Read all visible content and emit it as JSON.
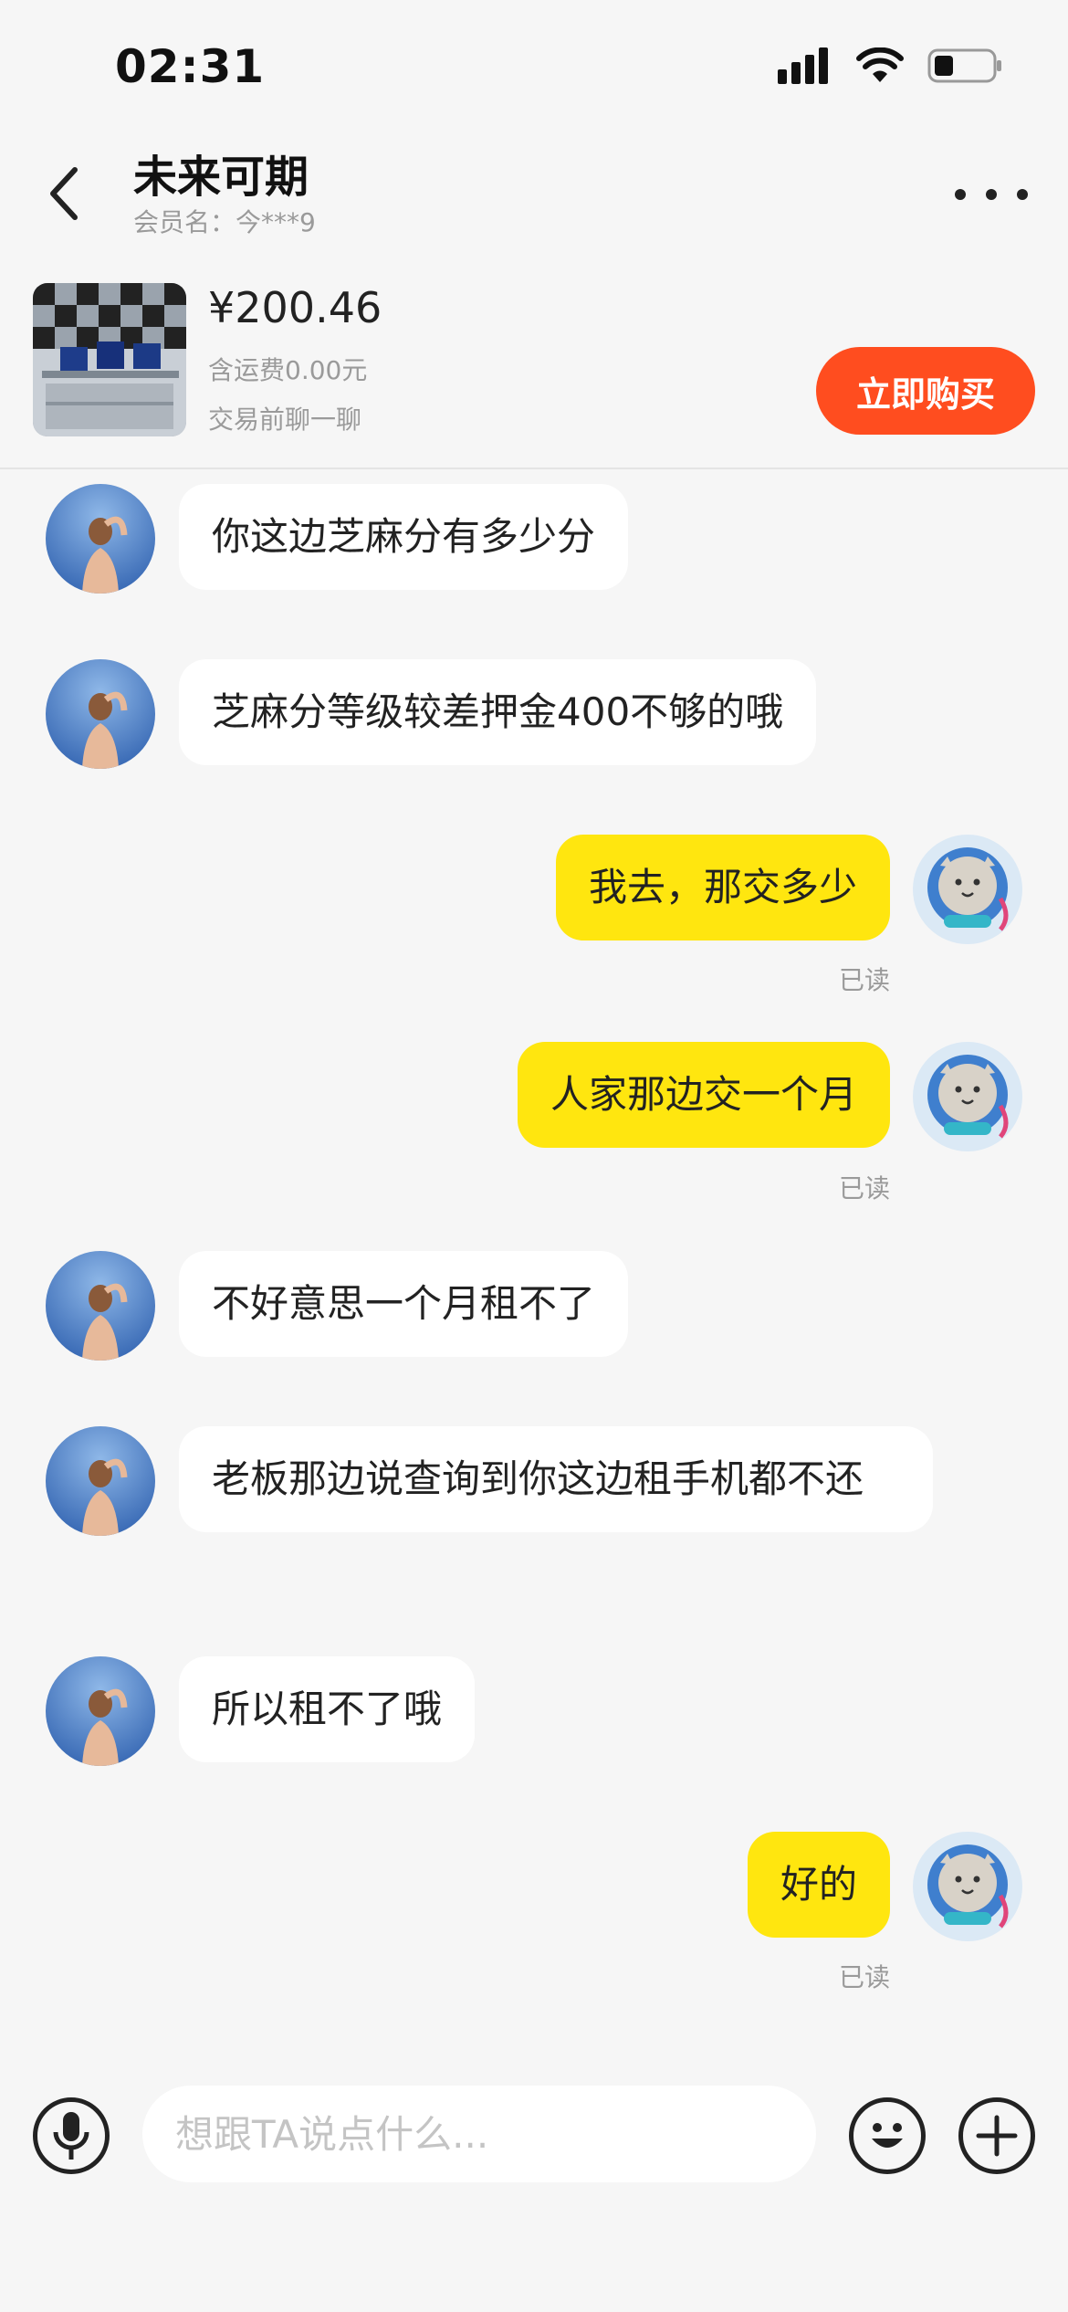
{
  "status_bar": {
    "time": "02:31"
  },
  "header": {
    "title": "未来可期",
    "subtitle": "会员名：今***9"
  },
  "product": {
    "price": "¥200.46",
    "shipping": "含运费0.00元",
    "pre_chat": "交易前聊一聊",
    "buy_label": "立即购买"
  },
  "messages": [
    {
      "from": "seller",
      "text": "你这边芝麻分有多少分"
    },
    {
      "from": "seller",
      "text": "芝麻分等级较差押金400不够的哦"
    },
    {
      "from": "me",
      "text": "我去，那交多少",
      "status": "已读"
    },
    {
      "from": "me",
      "text": "人家那边交一个月",
      "status": "已读"
    },
    {
      "from": "seller",
      "text": "不好意思一个月租不了"
    },
    {
      "from": "seller",
      "text": "老板那边说查询到你这边租手机都不还"
    },
    {
      "from": "seller",
      "text": "所以租不了哦"
    },
    {
      "from": "me",
      "text": "好的",
      "status": "已读"
    }
  ],
  "input": {
    "placeholder": "想跟TA说点什么..."
  },
  "icons": {
    "signal": "signal-icon",
    "wifi": "wifi-icon",
    "battery": "battery-icon",
    "back": "back-arrow-icon",
    "more": "more-dots-icon",
    "mic": "microphone-icon",
    "emoji": "emoji-icon",
    "plus": "plus-icon"
  },
  "colors": {
    "accent_yellow": "#ffe60f",
    "buy_orange": "#ff4d1f",
    "background": "#f6f6f6"
  }
}
